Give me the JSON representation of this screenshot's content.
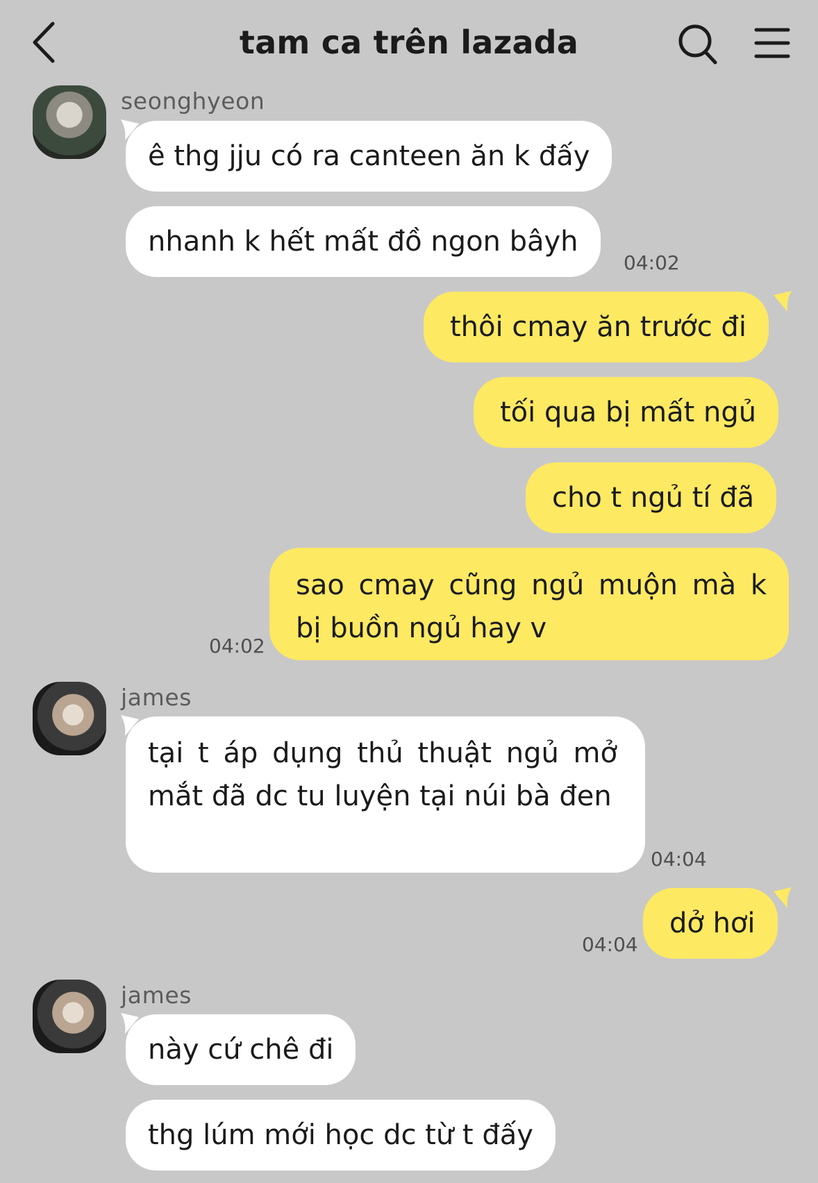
{
  "header": {
    "title": "tam ca trên lazada"
  },
  "icons": {
    "back": "chevron-left-icon",
    "search": "search-icon",
    "menu": "menu-icon"
  },
  "colors": {
    "background": "#c8c8c8",
    "incoming_bubble": "#ffffff",
    "outgoing_bubble": "#fde962",
    "timestamp": "#4f4f4f"
  },
  "messages": [
    {
      "sender": "seonghyeon",
      "direction": "incoming",
      "bubbles": [
        "ê thg jju có ra canteen ăn k đấy",
        "nhanh k hết mất đồ ngon bâyh"
      ],
      "time": "04:02"
    },
    {
      "direction": "outgoing",
      "bubbles": [
        "thôi cmay ăn trước đi",
        "tối qua bị mất ngủ",
        "cho t ngủ tí đã",
        "sao cmay cũng ngủ muộn mà k bị buồn ngủ hay v"
      ],
      "time": "04:02"
    },
    {
      "sender": "james",
      "direction": "incoming",
      "bubbles": [
        "tại t áp dụng thủ thuật ngủ mở mắt đã dc tu luyện tại núi bà đen"
      ],
      "time": "04:04"
    },
    {
      "direction": "outgoing",
      "bubbles": [
        "dở hơi"
      ],
      "time": "04:04"
    },
    {
      "sender": "james",
      "direction": "incoming",
      "bubbles": [
        "này cứ chê đi",
        "thg lúm mới học dc từ t đấy"
      ]
    }
  ]
}
